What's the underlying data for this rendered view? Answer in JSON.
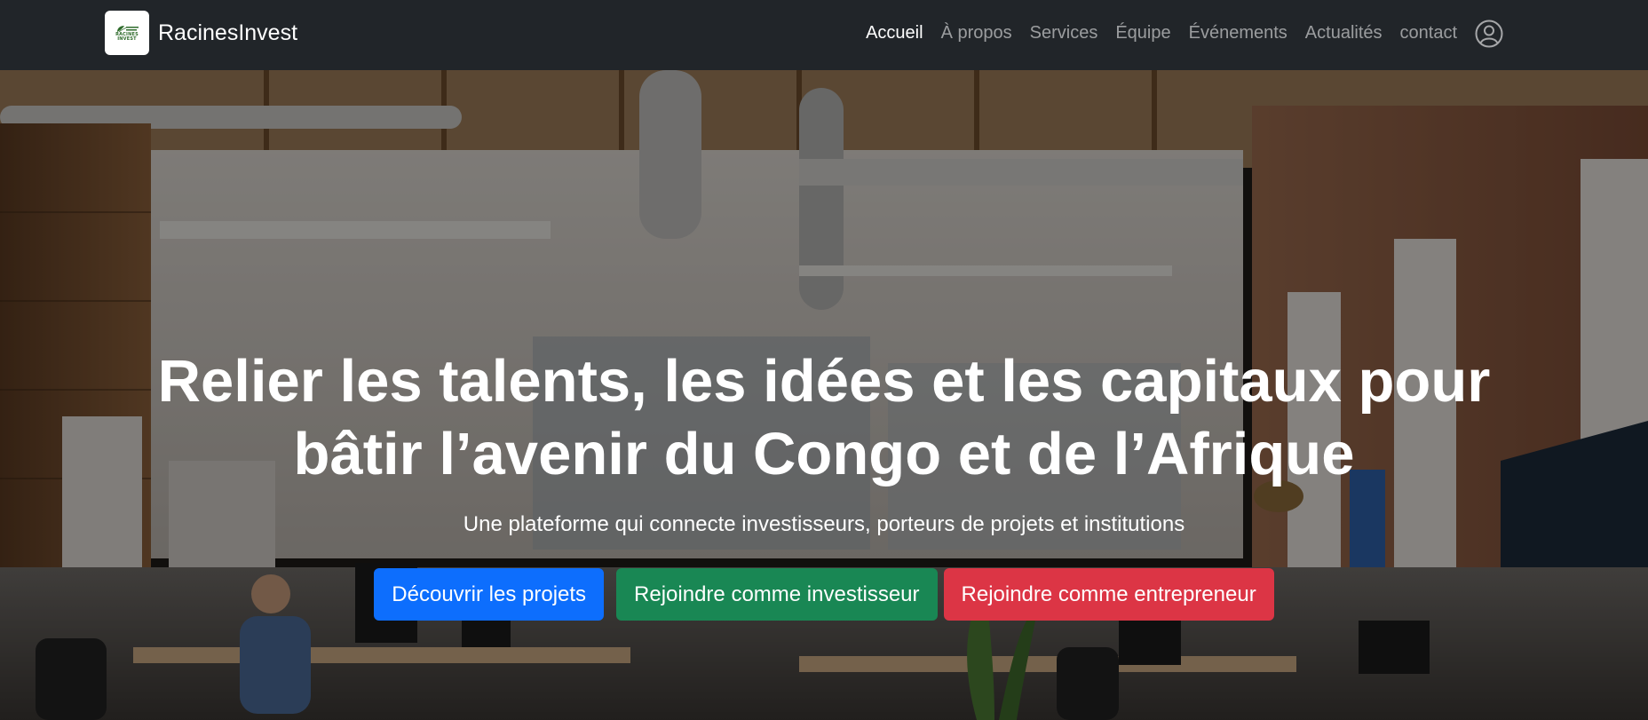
{
  "navbar": {
    "brand_name": "RacinesInvest",
    "logo": {
      "line1": "RACINES",
      "line2": "INVEST",
      "leaf_color": "#2e6b2b"
    },
    "links": [
      {
        "label": "Accueil",
        "active": true
      },
      {
        "label": "À propos",
        "active": false
      },
      {
        "label": "Services",
        "active": false
      },
      {
        "label": "Équipe",
        "active": false
      },
      {
        "label": "Événements",
        "active": false
      },
      {
        "label": "Actualités",
        "active": false
      },
      {
        "label": "contact",
        "active": false
      }
    ],
    "user_icon": "user-circle-icon",
    "background_color": "#212529"
  },
  "hero": {
    "background_image": "office-interior-photo",
    "title_line1": "Relier les talents, les idées et les capitaux pour",
    "title_line2": "bâtir l’avenir du Congo et de l’Afrique",
    "subtitle": "Une plateforme qui connecte investisseurs, porteurs de projets et institutions",
    "buttons": {
      "discover": {
        "label": "Découvrir les projets",
        "color": "#0d6efd"
      },
      "investor": {
        "label": "Rejoindre comme investisseur",
        "color": "#198754"
      },
      "entrepreneur": {
        "label": "Rejoindre comme entrepreneur",
        "color": "#dc3545"
      }
    }
  }
}
